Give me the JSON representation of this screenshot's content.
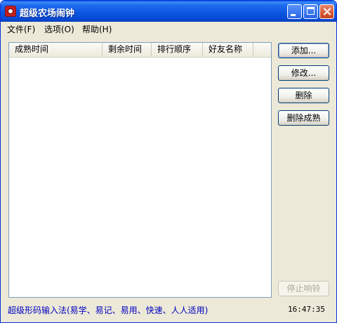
{
  "window": {
    "title": "超级农场闹钟"
  },
  "menu": {
    "file": "文件(F)",
    "options": "选项(O)",
    "help": "帮助(H)"
  },
  "list": {
    "columns": [
      "成熟时间",
      "剩余时间",
      "排行顺序",
      "好友名称"
    ]
  },
  "buttons": {
    "add": "添加...",
    "edit": "修改...",
    "delete": "删除",
    "delete_mature": "删除成熟",
    "stop_alarm": "停止响铃"
  },
  "status": {
    "ime": "超级形码输入法(易学、易记、易用、快速、人人适用)",
    "clock": "16:47:35"
  }
}
